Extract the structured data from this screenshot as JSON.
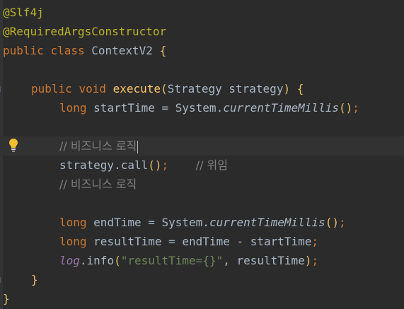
{
  "editor": {
    "lines": [
      {
        "parts": [
          {
            "t": "@Slf4j",
            "c": "ann"
          }
        ]
      },
      {
        "parts": [
          {
            "t": "@RequiredArgsConstructor",
            "c": "ann"
          }
        ]
      },
      {
        "parts": [
          {
            "t": "public ",
            "c": "kw"
          },
          {
            "t": "class ",
            "c": "kw"
          },
          {
            "t": "ContextV2 ",
            "c": ""
          },
          {
            "t": "{",
            "c": "brace"
          }
        ]
      },
      {
        "parts": []
      },
      {
        "parts": [
          {
            "t": "public ",
            "c": "kw"
          },
          {
            "t": "void ",
            "c": "kw"
          },
          {
            "t": "execute",
            "c": "fn"
          },
          {
            "t": "(",
            "c": "brace"
          },
          {
            "t": "Strategy strategy",
            "c": ""
          },
          {
            "t": ") ",
            "c": "brace"
          },
          {
            "t": "{",
            "c": "brace"
          }
        ]
      },
      {
        "parts": [
          {
            "t": "long ",
            "c": "kw"
          },
          {
            "t": "startTime = System.",
            "c": ""
          },
          {
            "t": "currentTimeMillis",
            "c": "it"
          },
          {
            "t": "()",
            "c": "brace"
          },
          {
            "t": ";",
            "c": "kw"
          }
        ]
      },
      {
        "parts": []
      },
      {
        "parts": [
          {
            "t": "// 비즈니스 로직",
            "c": "cm"
          }
        ]
      },
      {
        "parts": [
          {
            "t": "strategy.call",
            "c": ""
          },
          {
            "t": "()",
            "c": "brace"
          },
          {
            "t": ";",
            "c": "kw"
          },
          {
            "t": "    ",
            "c": ""
          },
          {
            "t": "// 위임",
            "c": "cm"
          }
        ]
      },
      {
        "parts": [
          {
            "t": "// 비즈니스 로직",
            "c": "cm"
          }
        ]
      },
      {
        "parts": []
      },
      {
        "parts": [
          {
            "t": "long ",
            "c": "kw"
          },
          {
            "t": "endTime = System.",
            "c": ""
          },
          {
            "t": "currentTimeMillis",
            "c": "it"
          },
          {
            "t": "()",
            "c": "brace"
          },
          {
            "t": ";",
            "c": "kw"
          }
        ]
      },
      {
        "parts": [
          {
            "t": "long ",
            "c": "kw"
          },
          {
            "t": "resultTime = endTime - startTime",
            "c": ""
          },
          {
            "t": ";",
            "c": "kw"
          }
        ]
      },
      {
        "parts": [
          {
            "t": "log",
            "c": "fld"
          },
          {
            "t": ".info",
            "c": ""
          },
          {
            "t": "(",
            "c": "brace"
          },
          {
            "t": "\"resultTime={}\"",
            "c": "str"
          },
          {
            "t": ", resultTime",
            "c": ""
          },
          {
            "t": ")",
            "c": "brace"
          },
          {
            "t": ";",
            "c": "kw"
          }
        ]
      },
      {
        "parts": [
          {
            "t": "}",
            "c": "brace"
          }
        ]
      },
      {
        "parts": [
          {
            "t": "}",
            "c": "brace"
          }
        ]
      }
    ],
    "icons": {
      "bulb": "lightbulb-icon"
    },
    "colors": {
      "background": "#2b2b2b",
      "keyword": "#cc7832",
      "annotation": "#bbb529",
      "method": "#ffc66d",
      "comment": "#808080",
      "string": "#6a8759",
      "field": "#9876aa"
    }
  }
}
